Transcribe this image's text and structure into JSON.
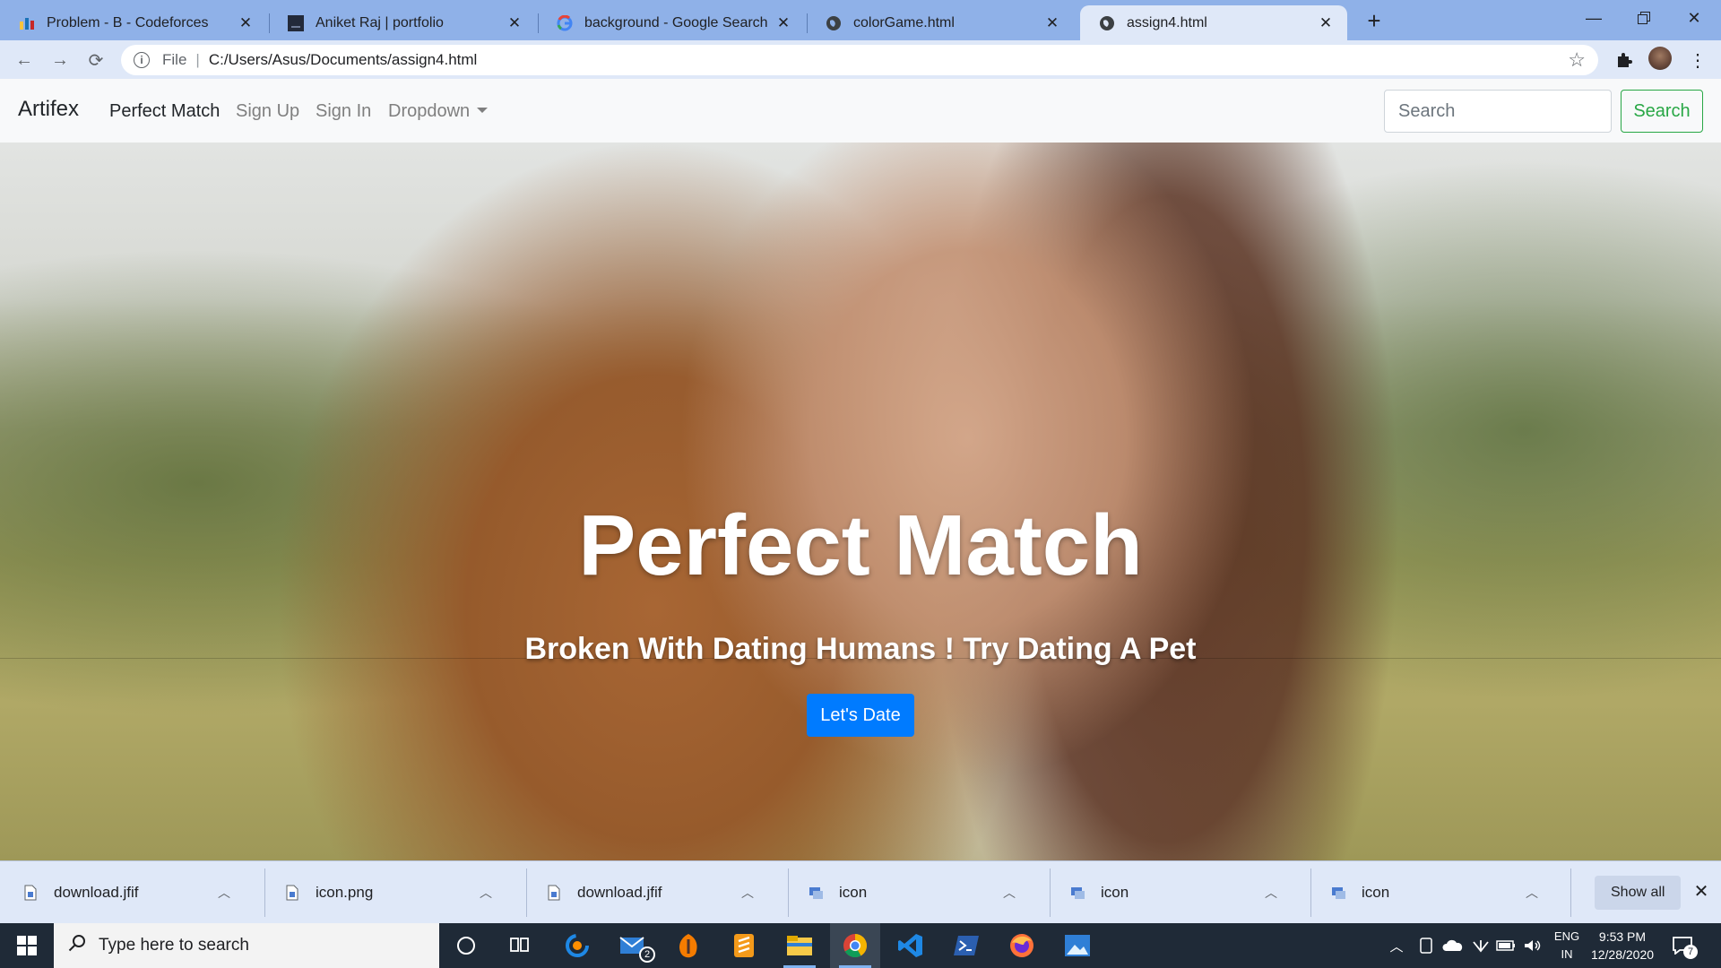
{
  "browser": {
    "tabs": [
      {
        "title": "Problem - B - Codeforces",
        "icon": "codeforces-icon"
      },
      {
        "title": "Aniket Raj | portfolio",
        "icon": "portfolio-icon"
      },
      {
        "title": "background - Google Search",
        "icon": "google-icon"
      },
      {
        "title": "colorGame.html",
        "icon": "globe-icon"
      },
      {
        "title": "assign4.html",
        "icon": "globe-icon",
        "active": true
      }
    ],
    "address": {
      "scheme": "File",
      "url": "C:/Users/Asus/Documents/assign4.html"
    }
  },
  "site": {
    "brand": "Artifex",
    "nav": {
      "perfect_match": "Perfect Match",
      "sign_up": "Sign Up",
      "sign_in": "Sign In",
      "dropdown": "Dropdown"
    },
    "search": {
      "placeholder": "Search",
      "button": "Search"
    },
    "hero": {
      "title": "Perfect Match",
      "subtitle": "Broken With Dating Humans ! Try Dating A Pet",
      "cta": "Let's Date"
    }
  },
  "downloads": {
    "items": [
      {
        "name": "download.jfif"
      },
      {
        "name": "icon.png"
      },
      {
        "name": "download.jfif"
      },
      {
        "name": "icon"
      },
      {
        "name": "icon"
      },
      {
        "name": "icon"
      }
    ],
    "show_all": "Show all"
  },
  "taskbar": {
    "search_placeholder": "Type here to search",
    "mail_badge": "2",
    "language": {
      "line1": "ENG",
      "line2": "IN"
    },
    "time": "9:53 PM",
    "date": "12/28/2020",
    "notification_count": "7"
  },
  "colors": {
    "primary": "#007bff",
    "success": "#28a745",
    "tab_strip": "#8fb1e8",
    "toolbar": "#dfe8f8",
    "taskbar": "#1f2a37"
  }
}
